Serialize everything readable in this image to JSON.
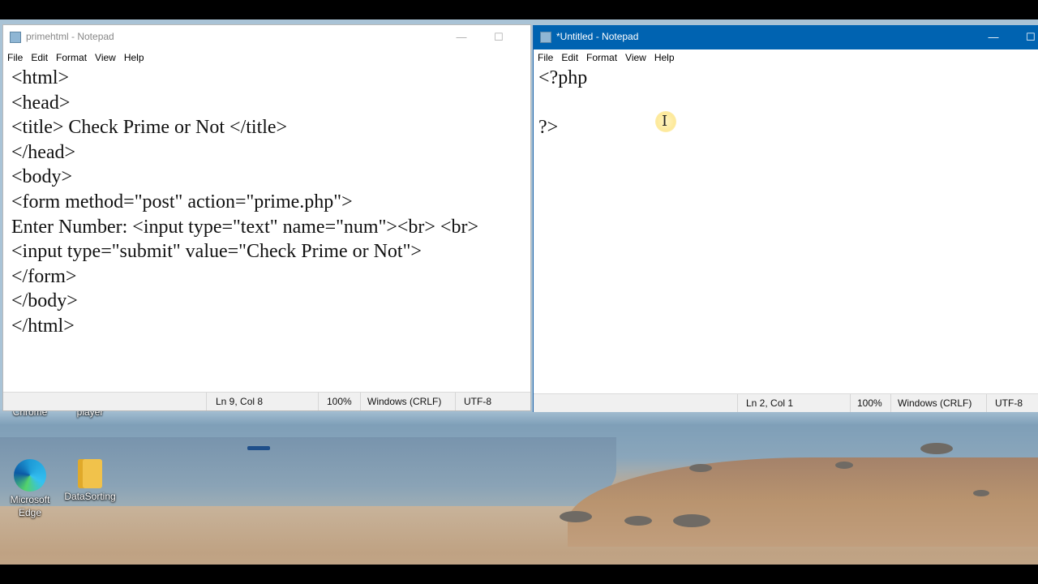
{
  "desktop": {
    "icons": [
      {
        "label": "Google Chrome"
      },
      {
        "label": "VLC media player"
      },
      {
        "label": "Microsoft Edge"
      },
      {
        "label": "DataSorting"
      }
    ]
  },
  "left_window": {
    "title": "primehtml - Notepad",
    "controls": {
      "minimize": "—",
      "maximize": "☐"
    },
    "menu": [
      "File",
      "Edit",
      "Format",
      "View",
      "Help"
    ],
    "content": "<html>\n<head>\n<title> Check Prime or Not </title>\n</head>\n<body>\n<form method=\"post\" action=\"prime.php\">\nEnter Number: <input type=\"text\" name=\"num\"><br> <br>\n<input type=\"submit\" value=\"Check Prime or Not\">\n</form>\n</body>\n</html>",
    "status": {
      "position": "Ln 9, Col 8",
      "zoom": "100%",
      "line_ending": "Windows (CRLF)",
      "encoding": "UTF-8"
    }
  },
  "right_window": {
    "title": "*Untitled - Notepad",
    "controls": {
      "minimize": "—",
      "maximize": "☐"
    },
    "menu": [
      "File",
      "Edit",
      "Format",
      "View",
      "Help"
    ],
    "content": "<?php\n\n?>",
    "status": {
      "position": "Ln 2, Col 1",
      "zoom": "100%",
      "line_ending": "Windows (CRLF)",
      "encoding": "UTF-8"
    }
  },
  "cursor": {
    "glyph": "I"
  }
}
